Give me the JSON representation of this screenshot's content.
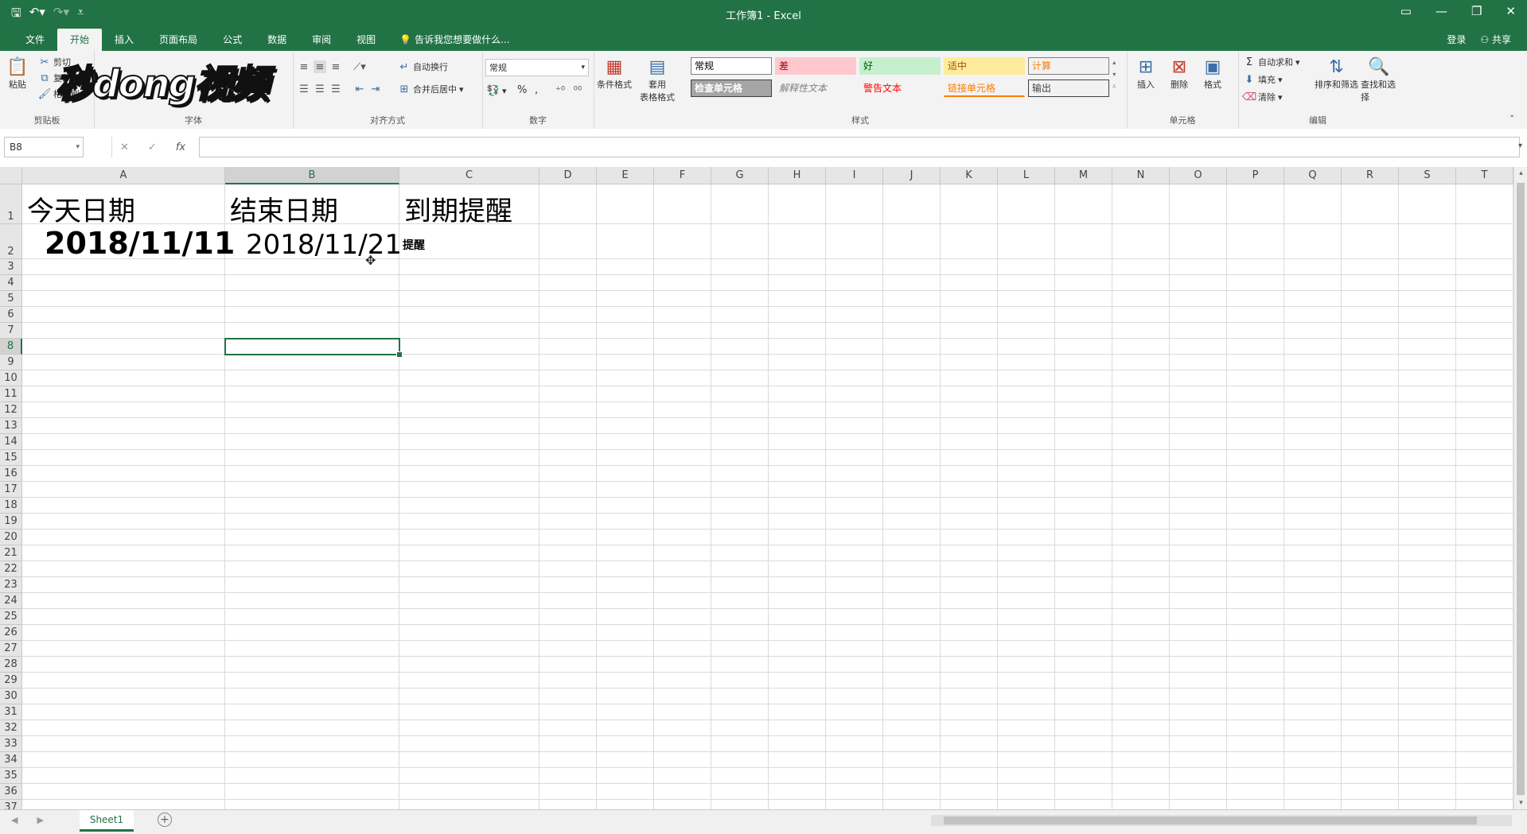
{
  "titlebar": {
    "title": "工作簿1 - Excel",
    "qat": {
      "save": "🖫",
      "undo": "↶▾",
      "redo": "↷▾",
      "customize": "⩡"
    },
    "controls": {
      "ribbon_display": "▭",
      "minimize": "—",
      "restore": "❐",
      "close": "✕"
    }
  },
  "tabs": {
    "items": [
      "文件",
      "开始",
      "插入",
      "页面布局",
      "公式",
      "数据",
      "审阅",
      "视图"
    ],
    "active": "开始",
    "tell_me": "告诉我您想要做什么...",
    "login": "登录",
    "share": "共享"
  },
  "ribbon": {
    "clipboard": {
      "label": "剪贴板",
      "paste": "粘贴",
      "cut": "剪切",
      "copy": "复制",
      "painter": "格式刷"
    },
    "font": {
      "label": "字体"
    },
    "alignment": {
      "label": "对齐方式",
      "wrap": "自动换行",
      "merge": "合并后居中"
    },
    "number": {
      "label": "数字",
      "format": "常规",
      "percent": "%",
      "comma": ","
    },
    "styles": {
      "label": "样式",
      "conditional": "条件格式",
      "table": "套用\n表格格式",
      "cells": [
        {
          "name": "常规",
          "bg": "#ffffff",
          "color": "#000000",
          "border": "#7f7f7f"
        },
        {
          "name": "差",
          "bg": "#ffc7ce",
          "color": "#9c0006",
          "border": "#ffc7ce"
        },
        {
          "name": "好",
          "bg": "#c6efce",
          "color": "#006100",
          "border": "#c6efce"
        },
        {
          "name": "适中",
          "bg": "#ffeb9c",
          "color": "#9c5700",
          "border": "#ffeb9c"
        },
        {
          "name": "计算",
          "bg": "#f2f2f2",
          "color": "#fa7d00",
          "border": "#7f7f7f"
        },
        {
          "name": "检查单元格",
          "bg": "#a5a5a5",
          "color": "#ffffff",
          "border": "#3f3f3f"
        },
        {
          "name": "解释性文本",
          "bg": "#f3f3f3",
          "color": "#7f7f7f",
          "border": "#f3f3f3"
        },
        {
          "name": "警告文本",
          "bg": "#f3f3f3",
          "color": "#ff0000",
          "border": "#f3f3f3"
        },
        {
          "name": "链接单元格",
          "bg": "#f3f3f3",
          "color": "#fa7d00",
          "border": "#f3f3f3"
        },
        {
          "name": "输出",
          "bg": "#f2f2f2",
          "color": "#3f3f3f",
          "border": "#3f3f3f"
        }
      ]
    },
    "cells_group": {
      "label": "单元格",
      "insert": "插入",
      "delete": "删除",
      "format": "格式"
    },
    "editing": {
      "label": "编辑",
      "autosum": "自动求和",
      "fill": "填充",
      "clear": "清除",
      "sort": "排序和筛选",
      "find": "查找和选择"
    }
  },
  "watermark": "秒dong视频",
  "formula_bar": {
    "name_box": "B8",
    "cancel": "✕",
    "enter": "✓",
    "fx": "fx",
    "value": ""
  },
  "grid": {
    "columns": [
      "A",
      "B",
      "C",
      "D",
      "E",
      "F",
      "G",
      "H",
      "I",
      "J",
      "K",
      "L",
      "M",
      "N",
      "O",
      "P",
      "Q",
      "R",
      "S",
      "T"
    ],
    "rows": [
      "1",
      "2",
      "3",
      "4",
      "5",
      "6",
      "7",
      "8",
      "9",
      "10",
      "11",
      "12",
      "13",
      "14",
      "15",
      "16",
      "17",
      "18",
      "19",
      "20",
      "21",
      "22",
      "23",
      "24",
      "25",
      "26",
      "27",
      "28",
      "29",
      "30",
      "31",
      "32",
      "33",
      "34",
      "35",
      "36",
      "37"
    ],
    "selected_column": "B",
    "selected_row": "8",
    "cells": {
      "A1": "今天日期",
      "B1": "结束日期",
      "C1": "到期提醒",
      "A2": "2018/11/11",
      "B2": "2018/11/21",
      "C2": "提醒"
    }
  },
  "sheets": {
    "tabs": [
      "Sheet1"
    ],
    "active": "Sheet1",
    "add": "+"
  },
  "colors": {
    "accent": "#217346",
    "gridline": "#dadada"
  }
}
